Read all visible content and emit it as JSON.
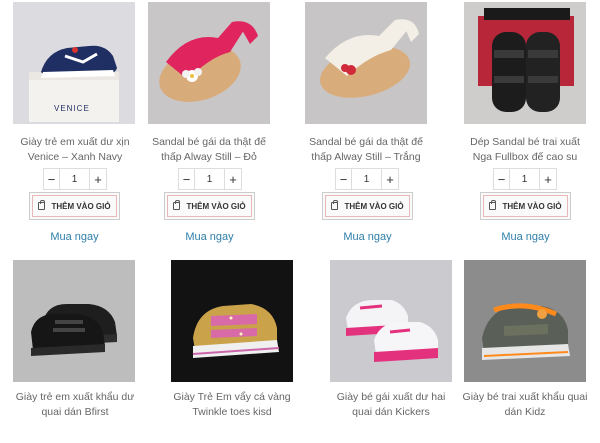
{
  "products": [
    {
      "name_line1": "Giày trẻ em xuất dư xịn",
      "name_line2": "Venice – Xanh Navy",
      "image": "navy-sneaker-on-box",
      "box_label": "VENICE"
    },
    {
      "name_line1": "Sandal bé gái da thật đế",
      "name_line2": "thấp Alway Still – Đỏ",
      "image": "red-girl-sandal"
    },
    {
      "name_line1": "Sandal bé gái da thật đế",
      "name_line2": "thấp Alway Still – Trắng",
      "image": "white-girl-sandal"
    },
    {
      "name_line1": "Dép Sandal bé trai xuất",
      "name_line2": "Nga Fullbox đế cao su",
      "image": "black-boy-sandal"
    },
    {
      "name_line1": "Giày trẻ em xuất khẩu dư",
      "name_line2": "quai dán Bfirst",
      "image": "black-sneaker"
    },
    {
      "name_line1": "Giày Trẻ Em vẩy cá vàng",
      "name_line2": "Twinkle toes kisd",
      "image": "gold-sequin-sneaker"
    },
    {
      "name_line1": "Giày bé gái xuất dư hai",
      "name_line2": "quai dán Kickers",
      "image": "white-pink-sneaker"
    },
    {
      "name_line1": "Giày bé trai xuất khẩu quai",
      "name_line2": "dán Kidz",
      "image": "grey-orange-sneaker"
    }
  ],
  "cart": {
    "quantity": "1",
    "minus": "−",
    "plus": "+",
    "add_to_cart_label": "THÊM VÀO GIỎ",
    "buy_now_label": "Mua ngay",
    "cart-icon": "shopping-bag-icon"
  },
  "colors": {
    "link": "#2e7fa8",
    "accent_border": "#e6b8b8",
    "photo_bg": "#d4d4d8"
  }
}
